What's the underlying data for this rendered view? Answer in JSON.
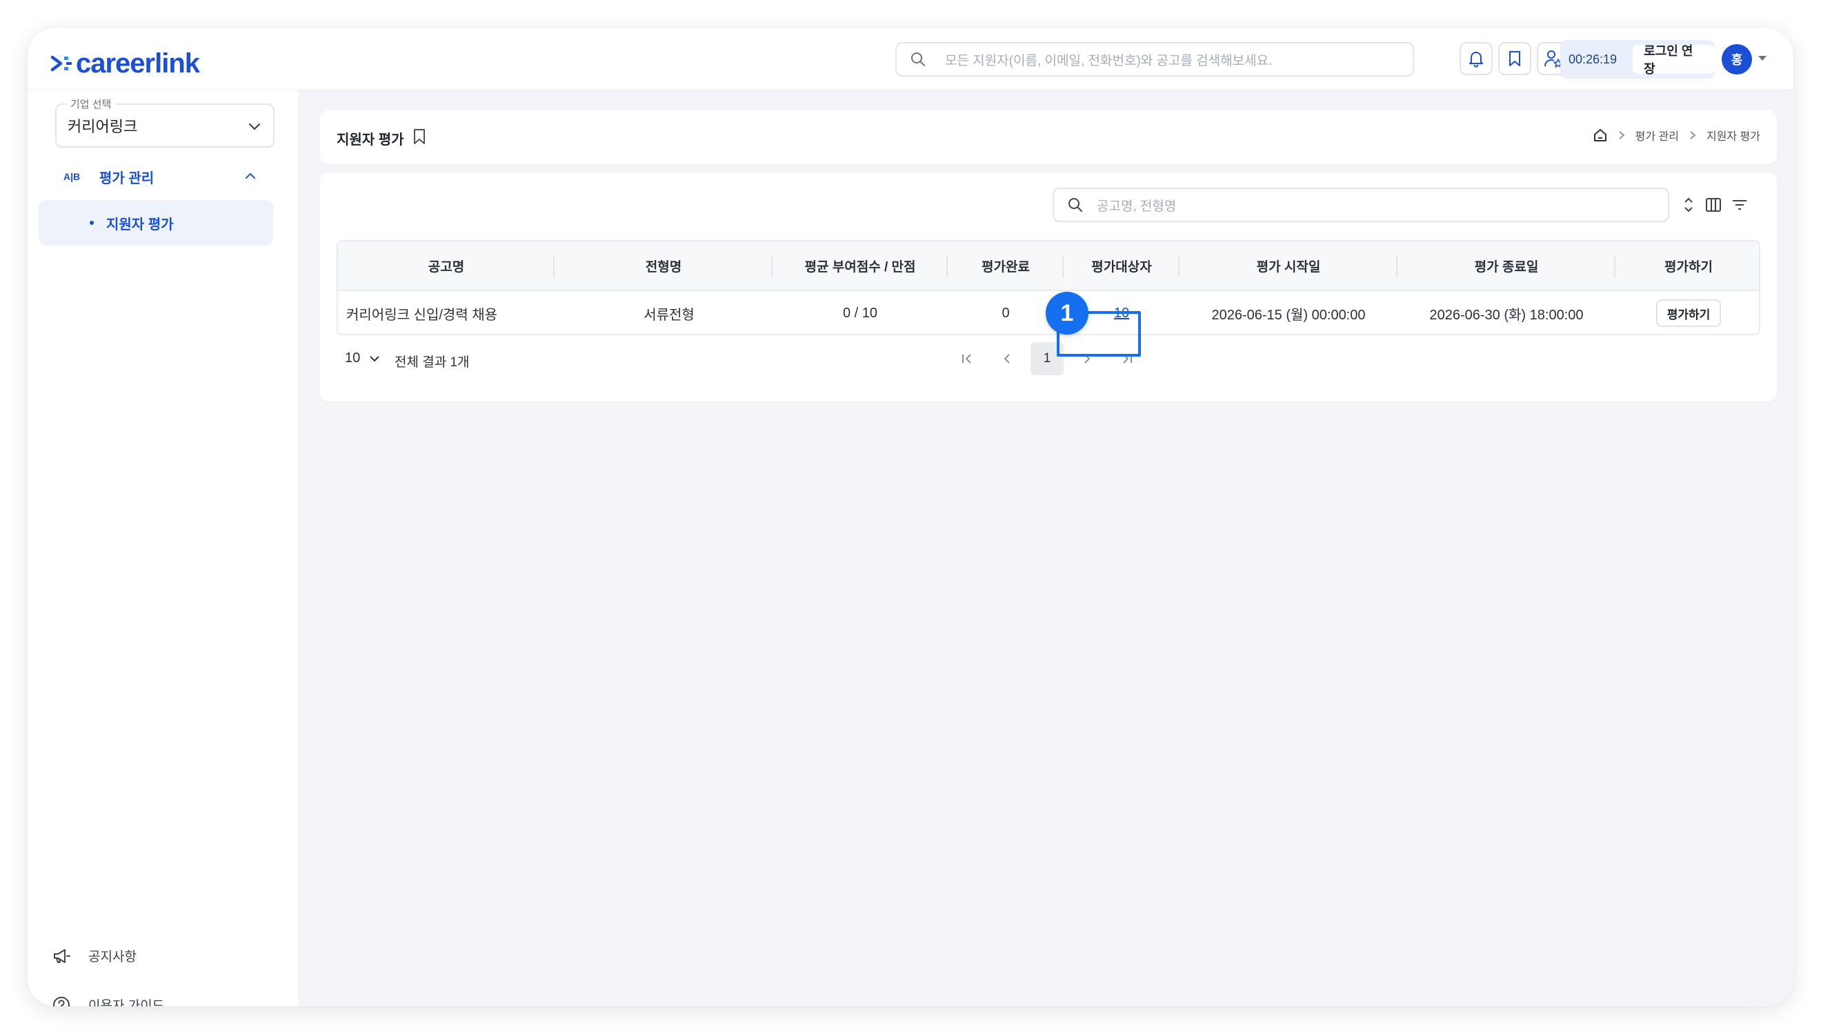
{
  "brand": {
    "name": "careerlink",
    "color": "#1a4fd6"
  },
  "header": {
    "search_placeholder": "모든 지원자(이름, 이메일, 전화번호)와 공고를 검색해보세요.",
    "session_timer": "00:26:19",
    "extend_label": "로그인 연장",
    "avatar_initial": "홍"
  },
  "sidebar": {
    "company_legend": "기업 선택",
    "company_value": "커리어링크",
    "group_badge": "A|B",
    "group_label": "평가 관리",
    "active_item": "지원자 평가",
    "footer": {
      "notice": "공지사항",
      "guide": "이용자 가이드"
    }
  },
  "page": {
    "title": "지원자 평가",
    "breadcrumb": [
      "평가 관리",
      "지원자 평가"
    ]
  },
  "list": {
    "search_placeholder": "공고명, 전형명",
    "columns": [
      "공고명",
      "전형명",
      "평균 부여점수 / 만점",
      "평가완료",
      "평가대상자",
      "평가 시작일",
      "평가 종료일",
      "평가하기"
    ],
    "rows": [
      {
        "posting": "커리어링크 신입/경력 채용",
        "stage": "서류전형",
        "score": "0 / 10",
        "completed": "0",
        "targets": "10",
        "start": "2026-06-15 (월) 00:00:00",
        "end": "2026-06-30 (화) 18:00:00",
        "action": "평가하기"
      }
    ],
    "page_size": "10",
    "total_text": "전체 결과 1개",
    "current_page": "1"
  },
  "annotation": {
    "step": "1",
    "color": "#1570ef"
  }
}
